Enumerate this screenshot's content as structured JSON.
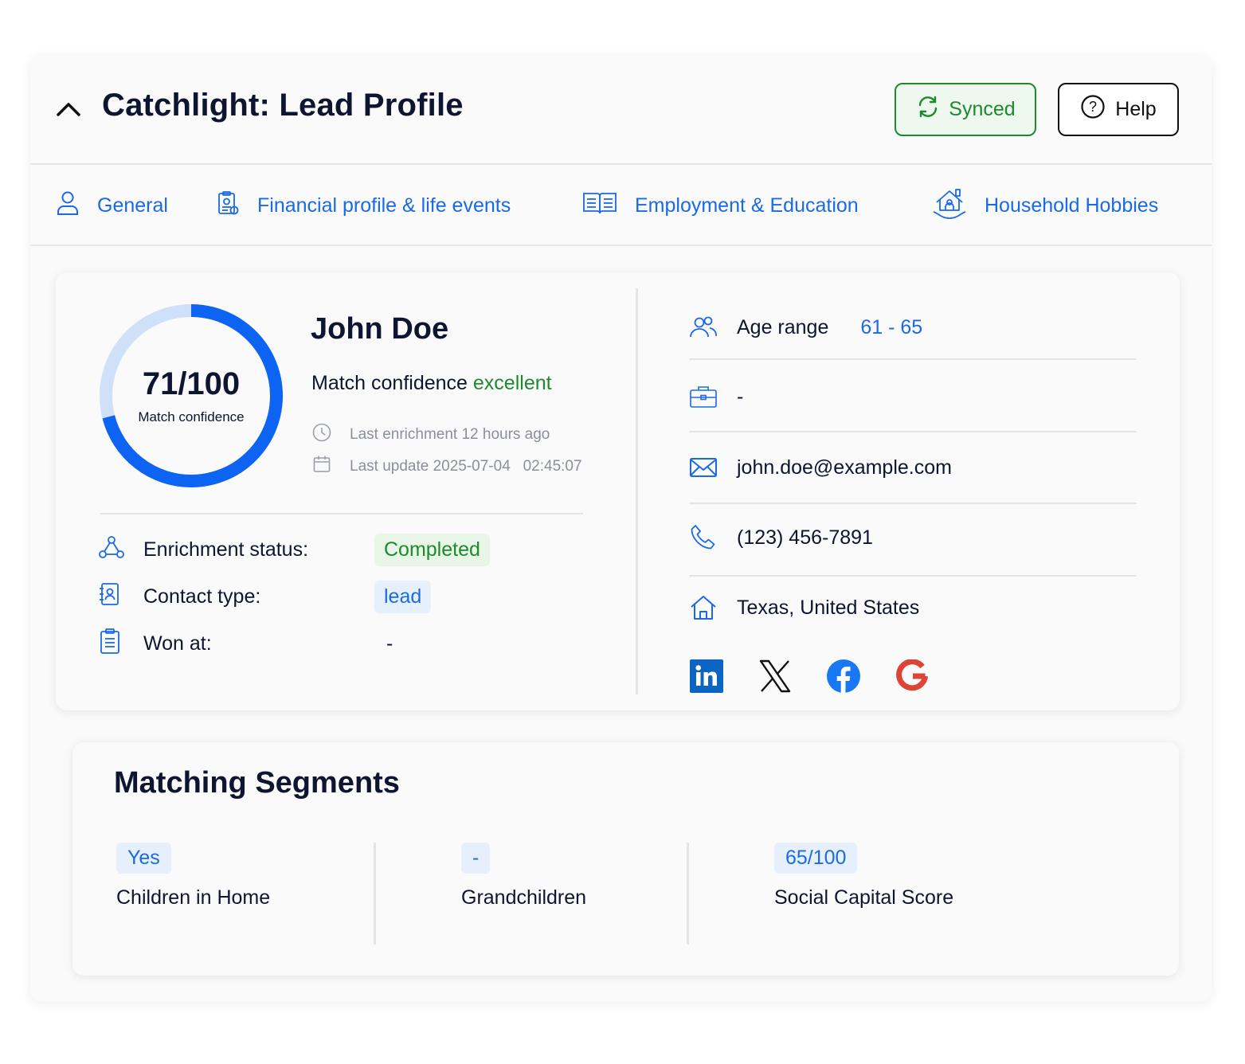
{
  "header": {
    "title": "Catchlight: Lead Profile",
    "synced_label": "Synced",
    "help_label": "Help"
  },
  "tabs": [
    {
      "label": "General",
      "icon": "person-icon"
    },
    {
      "label": "Financial profile & life events",
      "icon": "financial-document-icon"
    },
    {
      "label": "Employment & Education",
      "icon": "open-book-icon"
    },
    {
      "label": "Household Hobbies",
      "icon": "household-icon"
    }
  ],
  "profile": {
    "score": "71/100",
    "score_label": "Match confidence",
    "score_value": 71,
    "name": "John Doe",
    "confidence_prefix": "Match confidence",
    "confidence_value": "excellent",
    "last_enrichment": "Last enrichment 12 hours ago",
    "last_update": "Last update 2025-07-04   02:45:07"
  },
  "status_rows": {
    "enrichment_label": "Enrichment status:",
    "enrichment_value": "Completed",
    "contact_type_label": "Contact type:",
    "contact_type_value": "lead",
    "won_at_label": "Won at:",
    "won_at_value": "-"
  },
  "details": {
    "age_label": "Age range",
    "age_value": "61 - 65",
    "job_value": "-",
    "email": "john.doe@example.com",
    "phone": "(123) 456-7891",
    "location": "Texas, United States"
  },
  "segments": {
    "title": "Matching Segments",
    "items": [
      {
        "value": "Yes",
        "label": "Children in Home"
      },
      {
        "value": "-",
        "label": "Grandchildren"
      },
      {
        "value": "65/100",
        "label": "Social Capital Score"
      }
    ]
  },
  "colors": {
    "accent": "#1a6ae6",
    "donut_fill": "#0d63f2",
    "donut_track": "#cfe1f8",
    "success": "#1e8a2e"
  }
}
